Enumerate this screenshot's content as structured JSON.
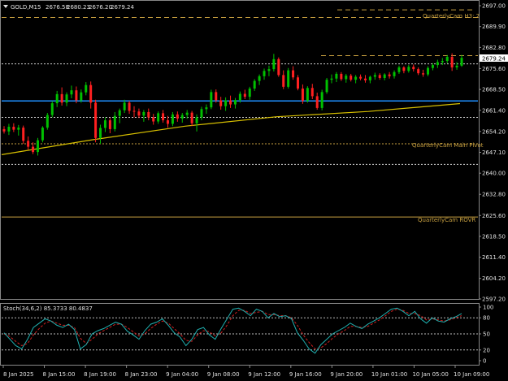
{
  "header": {
    "symbol": "GOLD,M15",
    "open": "2676.58",
    "high": "2680.23",
    "low": "2676.20",
    "close": "2679.24"
  },
  "price_axis": {
    "ticks": [
      "2697.00",
      "2689.90",
      "2682.80",
      "2675.60",
      "2668.50",
      "2661.40",
      "2654.20",
      "2647.10",
      "2640.00",
      "2632.80",
      "2625.60",
      "2618.50",
      "2611.40",
      "2604.20",
      "2597.20"
    ],
    "current_price": "2679.24"
  },
  "levels": {
    "h3_label": "QuarterlyCam H3: 2",
    "main_pivot_label": "QuarterlyCam Main Pivot",
    "rovr_label": "QuarterlyCam ROVR"
  },
  "stoch": {
    "label": "Stoch(34,6,2) 85.3733 80.4837",
    "ticks": [
      "100",
      "80",
      "50",
      "20",
      "0"
    ]
  },
  "time_axis": {
    "labels": [
      "8 Jan 2025",
      "8 Jan 15:00",
      "8 Jan 19:00",
      "8 Jan 23:00",
      "9 Jan 04:00",
      "9 Jan 08:00",
      "9 Jan 12:00",
      "9 Jan 16:00",
      "9 Jan 20:00",
      "10 Jan 01:00",
      "10 Jan 05:00",
      "10 Jan 09:00"
    ]
  },
  "colors": {
    "background": "#000000",
    "bull": "#00c000",
    "bear": "#ff2020",
    "ma": "#d8c000",
    "blue_line": "#1e90ff",
    "level": "#c8a040",
    "stoch_main": "#20b0b0",
    "stoch_signal": "#d02020"
  },
  "chart_data": {
    "type": "candlestick",
    "price_range": [
      2597.2,
      2697.0
    ],
    "candles": [
      [
        2655.0,
        2656.0,
        2653.5,
        2654.2
      ],
      [
        2654.2,
        2656.8,
        2653.0,
        2655.8
      ],
      [
        2655.8,
        2657.0,
        2654.0,
        2654.8
      ],
      [
        2654.8,
        2656.4,
        2652.8,
        2655.5
      ],
      [
        2655.5,
        2656.2,
        2650.0,
        2651.0
      ],
      [
        2651.0,
        2652.5,
        2648.0,
        2649.0
      ],
      [
        2649.0,
        2650.5,
        2646.5,
        2647.2
      ],
      [
        2647.2,
        2652.0,
        2646.0,
        2651.2
      ],
      [
        2651.2,
        2656.0,
        2650.5,
        2655.5
      ],
      [
        2655.5,
        2660.5,
        2654.8,
        2659.8
      ],
      [
        2659.8,
        2664.5,
        2659.0,
        2663.8
      ],
      [
        2663.8,
        2668.0,
        2662.5,
        2666.9
      ],
      [
        2666.9,
        2669.2,
        2663.0,
        2664.0
      ],
      [
        2664.0,
        2667.5,
        2662.8,
        2666.8
      ],
      [
        2666.8,
        2669.8,
        2665.5,
        2668.2
      ],
      [
        2668.2,
        2669.5,
        2663.8,
        2664.8
      ],
      [
        2664.8,
        2668.5,
        2664.0,
        2667.5
      ],
      [
        2667.5,
        2671.0,
        2666.5,
        2670.0
      ],
      [
        2670.0,
        2671.2,
        2662.0,
        2664.0
      ],
      [
        2664.0,
        2665.0,
        2650.5,
        2652.0
      ],
      [
        2652.0,
        2656.5,
        2650.0,
        2655.4
      ],
      [
        2655.4,
        2659.0,
        2654.0,
        2658.0
      ],
      [
        2658.0,
        2658.8,
        2653.6,
        2655.0
      ],
      [
        2655.0,
        2660.8,
        2654.2,
        2659.5
      ],
      [
        2659.5,
        2662.0,
        2657.0,
        2661.4
      ],
      [
        2661.4,
        2665.0,
        2660.5,
        2664.0
      ],
      [
        2664.0,
        2664.6,
        2660.2,
        2661.2
      ],
      [
        2661.2,
        2662.8,
        2659.0,
        2661.0
      ],
      [
        2661.0,
        2662.0,
        2658.8,
        2659.6
      ],
      [
        2659.6,
        2661.5,
        2657.5,
        2660.8
      ],
      [
        2660.8,
        2662.0,
        2658.0,
        2659.0
      ],
      [
        2659.0,
        2660.2,
        2656.5,
        2657.6
      ],
      [
        2657.6,
        2661.0,
        2656.8,
        2660.4
      ],
      [
        2660.4,
        2661.5,
        2657.2,
        2658.0
      ],
      [
        2658.0,
        2659.5,
        2655.5,
        2656.8
      ],
      [
        2656.8,
        2660.8,
        2656.0,
        2660.0
      ],
      [
        2660.0,
        2661.0,
        2657.5,
        2658.6
      ],
      [
        2658.6,
        2660.5,
        2657.2,
        2659.8
      ],
      [
        2659.8,
        2661.5,
        2658.5,
        2660.6
      ],
      [
        2660.6,
        2661.2,
        2656.0,
        2657.0
      ],
      [
        2657.0,
        2660.0,
        2654.2,
        2659.0
      ],
      [
        2659.0,
        2662.6,
        2658.0,
        2661.8
      ],
      [
        2661.8,
        2663.4,
        2660.2,
        2662.4
      ],
      [
        2662.4,
        2668.4,
        2661.8,
        2667.6
      ],
      [
        2667.6,
        2668.5,
        2664.0,
        2664.8
      ],
      [
        2664.8,
        2666.0,
        2661.6,
        2662.8
      ],
      [
        2662.8,
        2665.8,
        2661.2,
        2664.8
      ],
      [
        2664.8,
        2666.4,
        2662.2,
        2663.4
      ],
      [
        2663.4,
        2665.6,
        2662.0,
        2664.9
      ],
      [
        2664.9,
        2667.8,
        2664.0,
        2667.0
      ],
      [
        2667.0,
        2668.4,
        2665.2,
        2666.0
      ],
      [
        2666.0,
        2669.4,
        2665.0,
        2668.8
      ],
      [
        2668.8,
        2672.0,
        2668.0,
        2671.4
      ],
      [
        2671.4,
        2673.6,
        2670.0,
        2673.0
      ],
      [
        2673.0,
        2675.6,
        2671.8,
        2674.8
      ],
      [
        2674.8,
        2676.6,
        2673.0,
        2675.4
      ],
      [
        2675.4,
        2680.6,
        2674.6,
        2678.8
      ],
      [
        2678.8,
        2679.4,
        2672.8,
        2673.4
      ],
      [
        2673.4,
        2675.0,
        2668.6,
        2669.4
      ],
      [
        2669.4,
        2675.8,
        2668.8,
        2675.0
      ],
      [
        2675.0,
        2676.4,
        2671.8,
        2672.6
      ],
      [
        2672.6,
        2673.4,
        2668.2,
        2668.8
      ],
      [
        2668.8,
        2670.2,
        2663.6,
        2664.6
      ],
      [
        2664.6,
        2669.6,
        2664.0,
        2669.0
      ],
      [
        2669.0,
        2670.4,
        2665.2,
        2666.2
      ],
      [
        2666.2,
        2667.4,
        2661.6,
        2662.2
      ],
      [
        2662.2,
        2668.4,
        2661.4,
        2667.6
      ],
      [
        2667.6,
        2672.4,
        2667.0,
        2671.8
      ],
      [
        2671.8,
        2673.6,
        2670.6,
        2672.2
      ],
      [
        2672.2,
        2674.4,
        2671.0,
        2673.8
      ],
      [
        2673.8,
        2674.4,
        2671.4,
        2672.0
      ],
      [
        2672.0,
        2673.8,
        2670.8,
        2673.2
      ],
      [
        2673.2,
        2673.8,
        2671.2,
        2671.8
      ],
      [
        2671.8,
        2673.4,
        2670.6,
        2672.8
      ],
      [
        2672.8,
        2673.6,
        2671.6,
        2672.2
      ],
      [
        2672.2,
        2673.4,
        2670.8,
        2671.6
      ],
      [
        2671.6,
        2673.2,
        2670.6,
        2672.8
      ],
      [
        2672.8,
        2674.2,
        2671.8,
        2673.4
      ],
      [
        2673.4,
        2674.0,
        2671.8,
        2672.4
      ],
      [
        2672.4,
        2674.0,
        2671.6,
        2673.6
      ],
      [
        2673.6,
        2674.4,
        2672.2,
        2673.0
      ],
      [
        2673.0,
        2675.0,
        2672.2,
        2674.4
      ],
      [
        2674.4,
        2676.6,
        2673.8,
        2676.0
      ],
      [
        2676.0,
        2676.4,
        2674.0,
        2674.8
      ],
      [
        2674.8,
        2676.8,
        2674.2,
        2676.2
      ],
      [
        2676.2,
        2677.0,
        2674.6,
        2675.4
      ],
      [
        2675.4,
        2676.0,
        2673.4,
        2674.0
      ],
      [
        2674.0,
        2675.2,
        2672.8,
        2673.6
      ],
      [
        2673.6,
        2676.4,
        2673.0,
        2675.8
      ],
      [
        2675.8,
        2677.4,
        2675.0,
        2676.8
      ],
      [
        2676.8,
        2678.6,
        2675.8,
        2677.8
      ],
      [
        2677.8,
        2679.2,
        2676.8,
        2678.2
      ],
      [
        2678.2,
        2680.2,
        2677.4,
        2679.6
      ],
      [
        2679.6,
        2680.8,
        2674.8,
        2676.0
      ],
      [
        2676.0,
        2677.8,
        2675.2,
        2676.58
      ],
      [
        2676.58,
        2680.23,
        2676.2,
        2679.24
      ]
    ],
    "ma": [
      2646.3,
      2651.4,
      2656.0,
      2659.2,
      2661.0,
      2663.7
    ],
    "horizontal_lines": {
      "h3": 2693.0,
      "h3_dash_top": 2695.6,
      "upper_dotted": 2677.2,
      "price_line": 2680.0,
      "blue": 2664.6,
      "dotted_1": 2659.0,
      "main_pivot": 2650.0,
      "dotted_2": 2643.0,
      "rovr": 2625.1
    },
    "stoch_main": [
      52,
      40,
      28,
      22,
      40,
      62,
      70,
      78,
      74,
      66,
      62,
      68,
      58,
      22,
      30,
      50,
      56,
      60,
      66,
      72,
      68,
      55,
      48,
      40,
      56,
      68,
      72,
      78,
      66,
      52,
      44,
      28,
      40,
      58,
      62,
      48,
      40,
      60,
      78,
      96,
      98,
      92,
      84,
      96,
      92,
      80,
      88,
      82,
      84,
      78,
      52,
      38,
      22,
      14,
      30,
      40,
      50,
      56,
      62,
      70,
      64,
      60,
      68,
      74,
      80,
      88,
      96,
      98,
      92,
      84,
      92,
      78,
      70,
      80,
      74,
      72,
      78,
      82,
      88
    ],
    "stoch_signal": [
      50,
      45,
      36,
      28,
      32,
      48,
      60,
      70,
      74,
      70,
      66,
      66,
      62,
      42,
      32,
      40,
      50,
      56,
      62,
      68,
      68,
      62,
      54,
      46,
      50,
      60,
      68,
      74,
      70,
      60,
      50,
      38,
      36,
      48,
      56,
      54,
      46,
      52,
      66,
      84,
      94,
      94,
      88,
      90,
      92,
      86,
      86,
      84,
      84,
      80,
      66,
      48,
      34,
      22,
      24,
      32,
      42,
      50,
      56,
      64,
      64,
      62,
      64,
      70,
      76,
      84,
      92,
      96,
      94,
      88,
      88,
      84,
      76,
      78,
      76,
      74,
      76,
      80,
      84
    ],
    "stoch_range": [
      0,
      100
    ]
  }
}
